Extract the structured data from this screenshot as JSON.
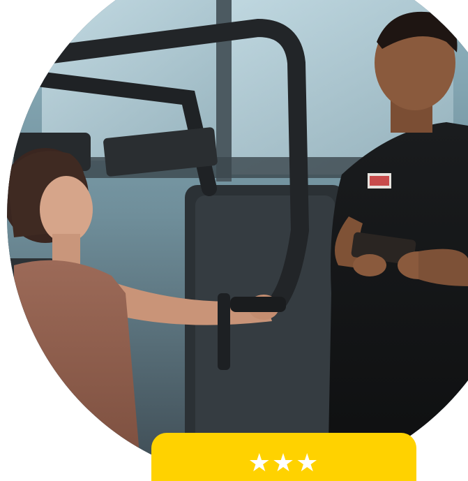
{
  "photo": {
    "subject": "gym-trainer-photo"
  },
  "rating_card": {
    "stars": 3,
    "star_glyph": "★",
    "color": "#ffd200",
    "star_color": "#ffffff"
  }
}
